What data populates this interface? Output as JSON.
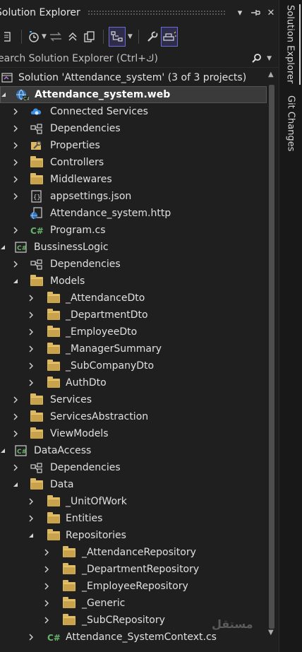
{
  "window": {
    "title": "Solution Explorer",
    "pin_glyph": "⊣",
    "close_glyph": "✕",
    "menu_glyph": "▾"
  },
  "toolbar": {
    "icons": [
      "solution-explorer-icon",
      "history-icon",
      "sync-icon",
      "collapse-all-icon",
      "show-all-files-icon",
      "view-toggle-icon",
      "properties-wrench-icon",
      "preview-icon"
    ]
  },
  "search": {
    "placeholder": "earch Solution Explorer (Ctrl+ك)",
    "search_glyph": "⚲"
  },
  "tree": {
    "solution_label": "Solution 'Attendance_system' (3 of 3 projects)",
    "rows": [
      {
        "label": "Attendance_system.web",
        "depth": 0,
        "expander": "open",
        "icon": "web-project-icon",
        "bold": true,
        "selected": true
      },
      {
        "label": "Connected Services",
        "depth": 1,
        "expander": "closed",
        "icon": "connected-services-icon"
      },
      {
        "label": "Dependencies",
        "depth": 1,
        "expander": "closed",
        "icon": "dependencies-icon"
      },
      {
        "label": "Properties",
        "depth": 1,
        "expander": "closed",
        "icon": "properties-icon"
      },
      {
        "label": "Controllers",
        "depth": 1,
        "expander": "closed",
        "icon": "folder-icon"
      },
      {
        "label": "Middlewares",
        "depth": 1,
        "expander": "closed",
        "icon": "folder-icon"
      },
      {
        "label": "appsettings.json",
        "depth": 1,
        "expander": "closed",
        "icon": "json-file-icon"
      },
      {
        "label": "Attendance_system.http",
        "depth": 1,
        "expander": "none",
        "icon": "http-file-icon"
      },
      {
        "label": "Program.cs",
        "depth": 1,
        "expander": "closed",
        "icon": "csharp-file-icon"
      },
      {
        "label": "BussinessLogic",
        "depth": 0,
        "expander": "open",
        "icon": "csharp-project-icon"
      },
      {
        "label": "Dependencies",
        "depth": 1,
        "expander": "closed",
        "icon": "dependencies-icon"
      },
      {
        "label": "Models",
        "depth": 1,
        "expander": "open",
        "icon": "folder-icon"
      },
      {
        "label": "_AttendanceDto",
        "depth": 2,
        "expander": "closed",
        "icon": "folder-icon"
      },
      {
        "label": "_DepartmentDto",
        "depth": 2,
        "expander": "closed",
        "icon": "folder-icon"
      },
      {
        "label": "_EmployeeDto",
        "depth": 2,
        "expander": "closed",
        "icon": "folder-icon"
      },
      {
        "label": "_ManagerSummary",
        "depth": 2,
        "expander": "closed",
        "icon": "folder-icon"
      },
      {
        "label": "_SubCompanyDto",
        "depth": 2,
        "expander": "closed",
        "icon": "folder-icon"
      },
      {
        "label": "AuthDto",
        "depth": 2,
        "expander": "closed",
        "icon": "folder-icon"
      },
      {
        "label": "Services",
        "depth": 1,
        "expander": "closed",
        "icon": "folder-icon"
      },
      {
        "label": "ServicesAbstraction",
        "depth": 1,
        "expander": "closed",
        "icon": "folder-icon"
      },
      {
        "label": "ViewModels",
        "depth": 1,
        "expander": "closed",
        "icon": "folder-icon"
      },
      {
        "label": "DataAccess",
        "depth": 0,
        "expander": "open",
        "icon": "csharp-project-icon"
      },
      {
        "label": "Dependencies",
        "depth": 1,
        "expander": "closed",
        "icon": "dependencies-icon"
      },
      {
        "label": "Data",
        "depth": 1,
        "expander": "open",
        "icon": "folder-icon"
      },
      {
        "label": "_UnitOfWork",
        "depth": 2,
        "expander": "closed",
        "icon": "folder-icon"
      },
      {
        "label": "Entities",
        "depth": 2,
        "expander": "closed",
        "icon": "folder-icon"
      },
      {
        "label": "Repositories",
        "depth": 2,
        "expander": "open",
        "icon": "folder-icon"
      },
      {
        "label": "_AttendanceRepository",
        "depth": 3,
        "expander": "closed",
        "icon": "folder-icon"
      },
      {
        "label": "_DepartmentRepository",
        "depth": 3,
        "expander": "closed",
        "icon": "folder-icon"
      },
      {
        "label": "_EmployeeRepository",
        "depth": 3,
        "expander": "closed",
        "icon": "folder-icon"
      },
      {
        "label": "_Generic",
        "depth": 3,
        "expander": "closed",
        "icon": "folder-icon"
      },
      {
        "label": "_SubCRepository",
        "depth": 3,
        "expander": "closed",
        "icon": "folder-icon"
      },
      {
        "label": "Attendance_SystemContext.cs",
        "depth": 2,
        "expander": "closed",
        "icon": "csharp-file-icon"
      }
    ]
  },
  "side_tabs": {
    "solution_explorer": "Solution Explorer",
    "git_changes": "Git Changes"
  },
  "watermark": "مستقل",
  "colors": {
    "background": "#1f1f1f",
    "selection": "#3a3a3a",
    "folder": "#dcb862",
    "accent": "#6b6bd6",
    "csharp": "#68b36b"
  }
}
